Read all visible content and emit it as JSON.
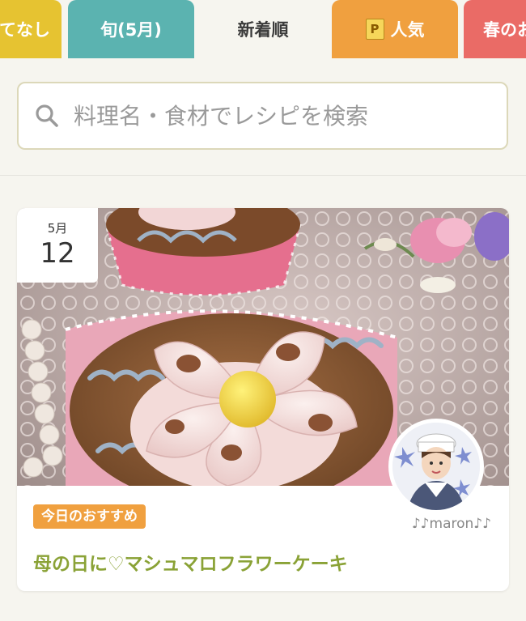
{
  "tabs": [
    {
      "label": "てなし",
      "color": "#e6c331"
    },
    {
      "label": "旬(5月)",
      "color": "#5bb3b0"
    },
    {
      "label": "新着順",
      "color": "#f6f5ef",
      "selected": true
    },
    {
      "label": "人気",
      "color": "#f0a03f",
      "icon": "premium-p-icon",
      "icon_text": "P"
    },
    {
      "label": "春のお",
      "color": "#ea6b66"
    }
  ],
  "search": {
    "placeholder": "料理名・食材でレシピを検索",
    "icon": "search-icon"
  },
  "card": {
    "date": {
      "month": "5月",
      "day": "12"
    },
    "badge": "今日のおすすめ",
    "author": "♪♪maron♪♪",
    "title": "母の日に♡マシュマロフラワーケーキ",
    "accent_color": "#8aa236"
  }
}
